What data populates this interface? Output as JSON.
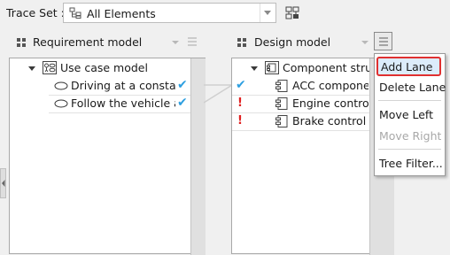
{
  "trace_set": {
    "label": "Trace Set :",
    "value": "All Elements",
    "icon": "element-tree-icon"
  },
  "toolbar": {
    "settings_icon": "trace-settings-icon"
  },
  "left_lane": {
    "title": "Requirement model",
    "tree": [
      {
        "label": "Use case model",
        "icon": "use-case-model-icon",
        "expanded": true
      },
      {
        "label": "Driving at a constan",
        "icon": "use-case-ellipse-icon",
        "status": "✔"
      },
      {
        "label": "Follow the vehicle al",
        "icon": "use-case-ellipse-icon",
        "status": "✔"
      }
    ]
  },
  "right_lane": {
    "title": "Design model",
    "tree": [
      {
        "label": "Component stru",
        "icon": "component-structure-icon",
        "expanded": true
      },
      {
        "label": "ACC compone",
        "icon": "component-icon",
        "status": "✔"
      },
      {
        "label": "Engine contro",
        "icon": "component-icon",
        "status": "!"
      },
      {
        "label": "Brake control",
        "icon": "component-icon",
        "status": "!"
      }
    ]
  },
  "context_menu": {
    "items": [
      {
        "label": "Add Lane",
        "highlighted": true
      },
      {
        "label": "Delete Lane"
      },
      {
        "label": "Move Left"
      },
      {
        "label": "Move Right",
        "disabled": true
      },
      {
        "label": "Tree Filter..."
      }
    ]
  },
  "colors": {
    "check": "#2d9fe0",
    "warning": "#e02020",
    "highlight_border": "#e03030"
  }
}
